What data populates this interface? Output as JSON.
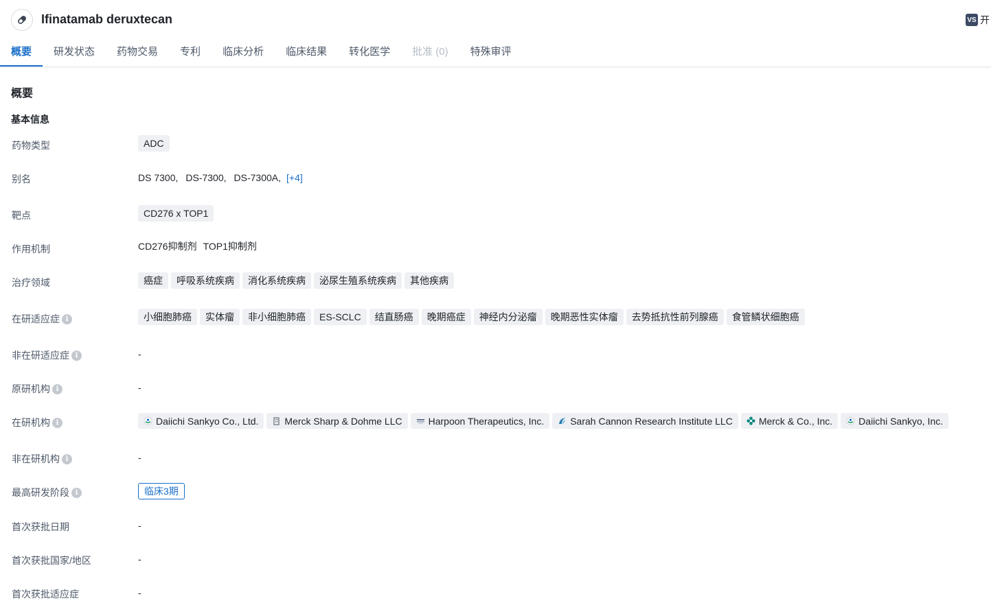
{
  "header": {
    "title": "Ifinatamab deruxtecan",
    "open_badge": "VS",
    "open_label": "开"
  },
  "tabs": [
    {
      "label": "概要",
      "state": "active"
    },
    {
      "label": "研发状态",
      "state": "normal"
    },
    {
      "label": "药物交易",
      "state": "normal"
    },
    {
      "label": "专利",
      "state": "normal"
    },
    {
      "label": "临床分析",
      "state": "normal"
    },
    {
      "label": "临床结果",
      "state": "normal"
    },
    {
      "label": "转化医学",
      "state": "normal"
    },
    {
      "label": "批准 (0)",
      "state": "disabled"
    },
    {
      "label": "特殊审评",
      "state": "normal"
    }
  ],
  "overview": {
    "section_title": "概要",
    "basic_info_title": "基本信息",
    "drug_type": {
      "label": "药物类型",
      "value": "ADC"
    },
    "aliases": {
      "label": "别名",
      "items": [
        "DS 7300,",
        "DS-7300,",
        "DS-7300A,"
      ],
      "more": "[+4]"
    },
    "target": {
      "label": "靶点",
      "value": "CD276 x TOP1"
    },
    "mechanism": {
      "label": "作用机制",
      "items": [
        "CD276抑制剂",
        "TOP1抑制剂"
      ]
    },
    "therapeutic_areas": {
      "label": "治疗领域",
      "items": [
        "癌症",
        "呼吸系统疾病",
        "消化系统疾病",
        "泌尿生殖系统疾病",
        "其他疾病"
      ]
    },
    "active_indications": {
      "label": "在研适应症",
      "items": [
        "小细胞肺癌",
        "实体瘤",
        "非小细胞肺癌",
        "ES-SCLC",
        "结直肠癌",
        "晚期癌症",
        "神经内分泌瘤",
        "晚期恶性实体瘤",
        "去势抵抗性前列腺癌",
        "食管鳞状细胞癌"
      ]
    },
    "inactive_indications": {
      "label": "非在研适应症",
      "value": "-"
    },
    "originator": {
      "label": "原研机构",
      "value": "-"
    },
    "active_orgs": {
      "label": "在研机构",
      "items": [
        {
          "name": "Daiichi Sankyo Co., Ltd.",
          "icon": "daiichi-logo-icon"
        },
        {
          "name": "Merck Sharp & Dohme LLC",
          "icon": "building-icon"
        },
        {
          "name": "Harpoon Therapeutics, Inc.",
          "icon": "harpoon-logo-icon"
        },
        {
          "name": "Sarah Cannon Research Institute LLC",
          "icon": "sarah-cannon-logo-icon"
        },
        {
          "name": "Merck & Co., Inc.",
          "icon": "merck-logo-icon"
        },
        {
          "name": "Daiichi Sankyo, Inc.",
          "icon": "daiichi-logo-icon"
        }
      ]
    },
    "inactive_orgs": {
      "label": "非在研机构",
      "value": "-"
    },
    "highest_phase": {
      "label": "最高研发阶段",
      "value": "临床3期"
    },
    "first_approval_date": {
      "label": "首次获批日期",
      "value": "-"
    },
    "first_approval_region": {
      "label": "首次获批国家/地区",
      "value": "-"
    },
    "first_approval_indication": {
      "label": "首次获批适应症",
      "value": "-"
    }
  },
  "colors": {
    "accent": "#1a6fc9",
    "chip_bg": "#eef0f3",
    "label_text": "#4e5969"
  }
}
